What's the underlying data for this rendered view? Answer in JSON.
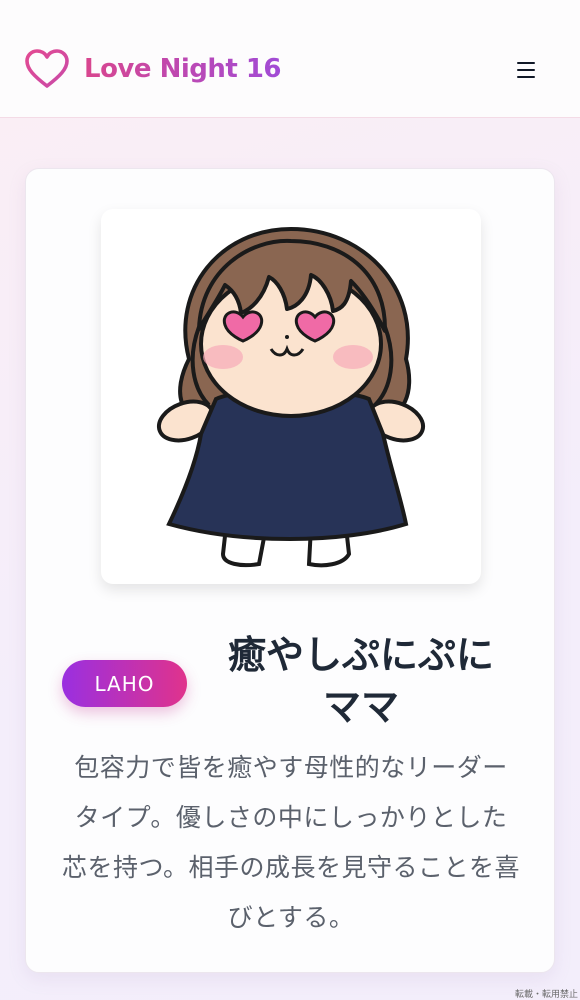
{
  "header": {
    "logo_text": "Love Night 16",
    "logo_icon": "heart-outline-icon",
    "menu_icon": "hamburger-menu-icon"
  },
  "colors": {
    "brand_pink": "#d9468e",
    "brand_purple": "#a14bd6",
    "badge_start": "#9a2fe0",
    "badge_end": "#e0338c",
    "title": "#1f2937",
    "description": "#5b616c"
  },
  "card": {
    "image_alt": "ぽっちゃりした女の子のイラスト",
    "type_code": "LAHO",
    "title": "癒やしぷにぷにママ",
    "description": "包容力で皆を癒やす母性的なリーダータイプ。優しさの中にしっかりとした芯を持つ。相手の成長を見守ることを喜びとする。"
  },
  "footer": {
    "notice": "転載・転用禁止"
  }
}
